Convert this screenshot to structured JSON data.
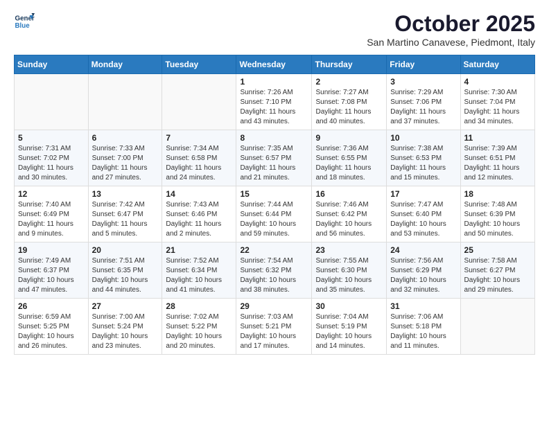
{
  "logo": {
    "line1": "General",
    "line2": "Blue"
  },
  "header": {
    "month": "October 2025",
    "location": "San Martino Canavese, Piedmont, Italy"
  },
  "weekdays": [
    "Sunday",
    "Monday",
    "Tuesday",
    "Wednesday",
    "Thursday",
    "Friday",
    "Saturday"
  ],
  "weeks": [
    [
      {
        "day": "",
        "info": ""
      },
      {
        "day": "",
        "info": ""
      },
      {
        "day": "",
        "info": ""
      },
      {
        "day": "1",
        "info": "Sunrise: 7:26 AM\nSunset: 7:10 PM\nDaylight: 11 hours\nand 43 minutes."
      },
      {
        "day": "2",
        "info": "Sunrise: 7:27 AM\nSunset: 7:08 PM\nDaylight: 11 hours\nand 40 minutes."
      },
      {
        "day": "3",
        "info": "Sunrise: 7:29 AM\nSunset: 7:06 PM\nDaylight: 11 hours\nand 37 minutes."
      },
      {
        "day": "4",
        "info": "Sunrise: 7:30 AM\nSunset: 7:04 PM\nDaylight: 11 hours\nand 34 minutes."
      }
    ],
    [
      {
        "day": "5",
        "info": "Sunrise: 7:31 AM\nSunset: 7:02 PM\nDaylight: 11 hours\nand 30 minutes."
      },
      {
        "day": "6",
        "info": "Sunrise: 7:33 AM\nSunset: 7:00 PM\nDaylight: 11 hours\nand 27 minutes."
      },
      {
        "day": "7",
        "info": "Sunrise: 7:34 AM\nSunset: 6:58 PM\nDaylight: 11 hours\nand 24 minutes."
      },
      {
        "day": "8",
        "info": "Sunrise: 7:35 AM\nSunset: 6:57 PM\nDaylight: 11 hours\nand 21 minutes."
      },
      {
        "day": "9",
        "info": "Sunrise: 7:36 AM\nSunset: 6:55 PM\nDaylight: 11 hours\nand 18 minutes."
      },
      {
        "day": "10",
        "info": "Sunrise: 7:38 AM\nSunset: 6:53 PM\nDaylight: 11 hours\nand 15 minutes."
      },
      {
        "day": "11",
        "info": "Sunrise: 7:39 AM\nSunset: 6:51 PM\nDaylight: 11 hours\nand 12 minutes."
      }
    ],
    [
      {
        "day": "12",
        "info": "Sunrise: 7:40 AM\nSunset: 6:49 PM\nDaylight: 11 hours\nand 9 minutes."
      },
      {
        "day": "13",
        "info": "Sunrise: 7:42 AM\nSunset: 6:47 PM\nDaylight: 11 hours\nand 5 minutes."
      },
      {
        "day": "14",
        "info": "Sunrise: 7:43 AM\nSunset: 6:46 PM\nDaylight: 11 hours\nand 2 minutes."
      },
      {
        "day": "15",
        "info": "Sunrise: 7:44 AM\nSunset: 6:44 PM\nDaylight: 10 hours\nand 59 minutes."
      },
      {
        "day": "16",
        "info": "Sunrise: 7:46 AM\nSunset: 6:42 PM\nDaylight: 10 hours\nand 56 minutes."
      },
      {
        "day": "17",
        "info": "Sunrise: 7:47 AM\nSunset: 6:40 PM\nDaylight: 10 hours\nand 53 minutes."
      },
      {
        "day": "18",
        "info": "Sunrise: 7:48 AM\nSunset: 6:39 PM\nDaylight: 10 hours\nand 50 minutes."
      }
    ],
    [
      {
        "day": "19",
        "info": "Sunrise: 7:49 AM\nSunset: 6:37 PM\nDaylight: 10 hours\nand 47 minutes."
      },
      {
        "day": "20",
        "info": "Sunrise: 7:51 AM\nSunset: 6:35 PM\nDaylight: 10 hours\nand 44 minutes."
      },
      {
        "day": "21",
        "info": "Sunrise: 7:52 AM\nSunset: 6:34 PM\nDaylight: 10 hours\nand 41 minutes."
      },
      {
        "day": "22",
        "info": "Sunrise: 7:54 AM\nSunset: 6:32 PM\nDaylight: 10 hours\nand 38 minutes."
      },
      {
        "day": "23",
        "info": "Sunrise: 7:55 AM\nSunset: 6:30 PM\nDaylight: 10 hours\nand 35 minutes."
      },
      {
        "day": "24",
        "info": "Sunrise: 7:56 AM\nSunset: 6:29 PM\nDaylight: 10 hours\nand 32 minutes."
      },
      {
        "day": "25",
        "info": "Sunrise: 7:58 AM\nSunset: 6:27 PM\nDaylight: 10 hours\nand 29 minutes."
      }
    ],
    [
      {
        "day": "26",
        "info": "Sunrise: 6:59 AM\nSunset: 5:25 PM\nDaylight: 10 hours\nand 26 minutes."
      },
      {
        "day": "27",
        "info": "Sunrise: 7:00 AM\nSunset: 5:24 PM\nDaylight: 10 hours\nand 23 minutes."
      },
      {
        "day": "28",
        "info": "Sunrise: 7:02 AM\nSunset: 5:22 PM\nDaylight: 10 hours\nand 20 minutes."
      },
      {
        "day": "29",
        "info": "Sunrise: 7:03 AM\nSunset: 5:21 PM\nDaylight: 10 hours\nand 17 minutes."
      },
      {
        "day": "30",
        "info": "Sunrise: 7:04 AM\nSunset: 5:19 PM\nDaylight: 10 hours\nand 14 minutes."
      },
      {
        "day": "31",
        "info": "Sunrise: 7:06 AM\nSunset: 5:18 PM\nDaylight: 10 hours\nand 11 minutes."
      },
      {
        "day": "",
        "info": ""
      }
    ]
  ]
}
